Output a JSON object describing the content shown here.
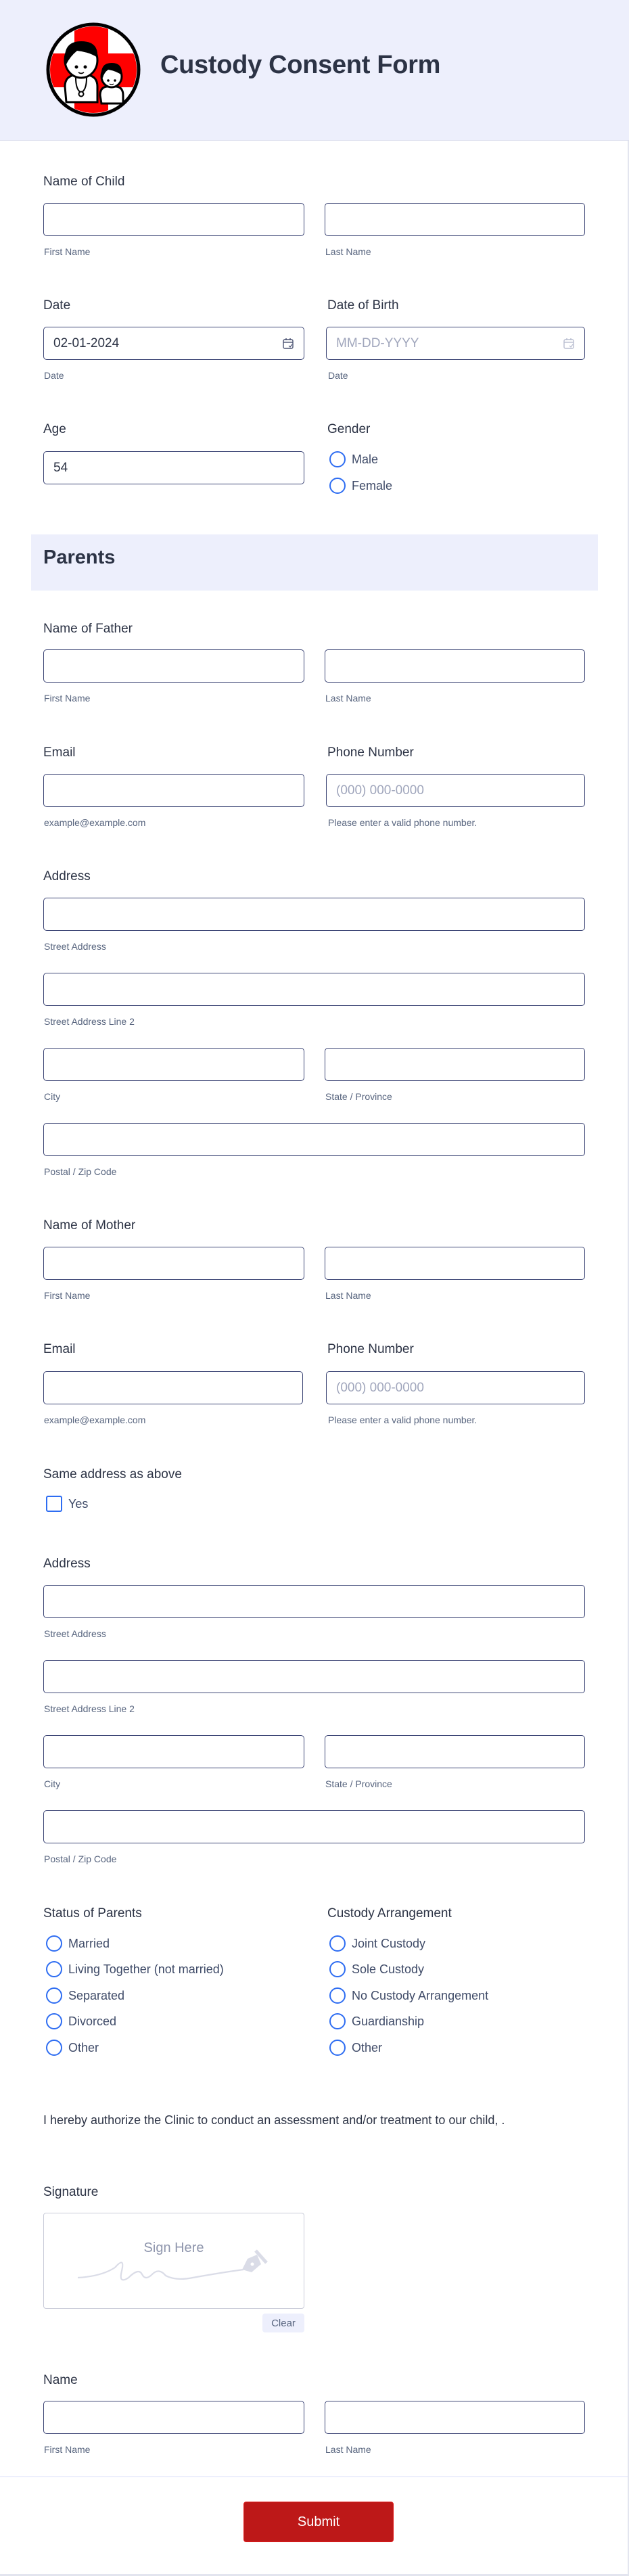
{
  "header": {
    "title": "Custody Consent Form",
    "logo_icon": "clinic-doctor-child-logo",
    "background": "#edeffc"
  },
  "child": {
    "name_label": "Name of Child",
    "first_name": {
      "value": "",
      "sublabel": "First Name"
    },
    "last_name": {
      "value": "",
      "sublabel": "Last Name"
    },
    "date": {
      "label": "Date",
      "value": "02-01-2024",
      "sublabel": "Date",
      "icon": "calendar-icon"
    },
    "dob": {
      "label": "Date of Birth",
      "placeholder": "MM-DD-YYYY",
      "sublabel": "Date",
      "icon": "calendar-icon"
    },
    "age": {
      "label": "Age",
      "value": "54"
    },
    "gender": {
      "label": "Gender",
      "options": [
        "Male",
        "Female"
      ],
      "selected": null
    }
  },
  "parents_section": {
    "title": "Parents"
  },
  "father": {
    "name_label": "Name of Father",
    "first_name": {
      "value": "",
      "sublabel": "First Name"
    },
    "last_name": {
      "value": "",
      "sublabel": "Last Name"
    },
    "email": {
      "label": "Email",
      "value": "",
      "sublabel": "example@example.com"
    },
    "phone": {
      "label": "Phone Number",
      "placeholder": "(000) 000-0000",
      "sublabel": "Please enter a valid phone number."
    },
    "address": {
      "label": "Address",
      "street": {
        "value": "",
        "sublabel": "Street Address"
      },
      "street2": {
        "value": "",
        "sublabel": "Street Address Line 2"
      },
      "city": {
        "value": "",
        "sublabel": "City"
      },
      "state": {
        "value": "",
        "sublabel": "State / Province"
      },
      "zip": {
        "value": "",
        "sublabel": "Postal / Zip Code"
      }
    }
  },
  "mother": {
    "name_label": "Name of Mother",
    "first_name": {
      "value": "",
      "sublabel": "First Name"
    },
    "last_name": {
      "value": "",
      "sublabel": "Last Name"
    },
    "email": {
      "label": "Email",
      "value": "",
      "sublabel": "example@example.com"
    },
    "phone": {
      "label": "Phone Number",
      "placeholder": "(000) 000-0000",
      "sublabel": "Please enter a valid phone number."
    },
    "same_address": {
      "label": "Same address as above",
      "option": "Yes",
      "checked": false
    },
    "address": {
      "label": "Address",
      "street": {
        "value": "",
        "sublabel": "Street Address"
      },
      "street2": {
        "value": "",
        "sublabel": "Street Address Line 2"
      },
      "city": {
        "value": "",
        "sublabel": "City"
      },
      "state": {
        "value": "",
        "sublabel": "State / Province"
      },
      "zip": {
        "value": "",
        "sublabel": "Postal / Zip Code"
      }
    }
  },
  "status_of_parents": {
    "label": "Status of Parents",
    "options": [
      "Married",
      "Living Together (not married)",
      "Separated",
      "Divorced",
      "Other"
    ],
    "selected": null
  },
  "custody_arrangement": {
    "label": "Custody Arrangement",
    "options": [
      "Joint Custody",
      "Sole Custody",
      "No Custody Arrangement",
      "Guardianship",
      "Other"
    ],
    "selected": null
  },
  "consent_text": "I hereby authorize the Clinic to conduct an assessment and/or treatment to our child, .",
  "signature": {
    "label": "Signature",
    "placeholder": "Sign Here",
    "clear_label": "Clear",
    "icon": "pen-nib-icon"
  },
  "signer_name": {
    "label": "Name",
    "first_name": {
      "value": "",
      "sublabel": "First Name"
    },
    "last_name": {
      "value": "",
      "sublabel": "Last Name"
    }
  },
  "submit": {
    "label": "Submit",
    "color": "#bd1818"
  },
  "colors": {
    "accent": "#2e6df2",
    "input_border": "#3c4575",
    "text": "#2c3345",
    "sublabel": "#57647e"
  }
}
